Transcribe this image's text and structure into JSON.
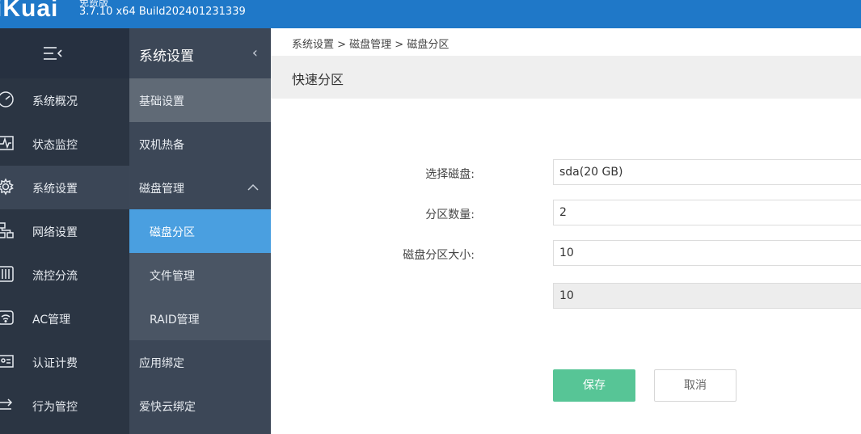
{
  "header": {
    "logo": "iKuai",
    "edition": "免费版",
    "version": "3.7.10 x64 Build202401231339"
  },
  "nav_primary": {
    "items": [
      {
        "label": "系统概况",
        "icon": "dashboard-icon"
      },
      {
        "label": "状态监控",
        "icon": "monitor-icon"
      },
      {
        "label": "系统设置",
        "icon": "gear-icon"
      },
      {
        "label": "网络设置",
        "icon": "network-icon"
      },
      {
        "label": "流控分流",
        "icon": "sliders-icon"
      },
      {
        "label": "AC管理",
        "icon": "wifi-icon"
      },
      {
        "label": "认证计费",
        "icon": "id-card-icon"
      },
      {
        "label": "行为管控",
        "icon": "behavior-icon"
      }
    ]
  },
  "nav_secondary": {
    "title": "系统设置",
    "items": [
      {
        "label": "基础设置"
      },
      {
        "label": "双机热备"
      },
      {
        "label": "磁盘管理"
      },
      {
        "label": "磁盘分区"
      },
      {
        "label": "文件管理"
      },
      {
        "label": "RAID管理"
      },
      {
        "label": "应用绑定"
      },
      {
        "label": "爱快云绑定"
      }
    ]
  },
  "breadcrumb": "系统设置 > 磁盘管理 > 磁盘分区",
  "panel": {
    "title": "快速分区",
    "fields": {
      "disk_label": "选择磁盘:",
      "disk_value": "sda(20 GB)",
      "count_label": "分区数量:",
      "count_value": "2",
      "size_label": "磁盘分区大小:",
      "size_value": "10",
      "size_value_2": "10"
    },
    "save_label": "保存",
    "cancel_label": "取消"
  }
}
